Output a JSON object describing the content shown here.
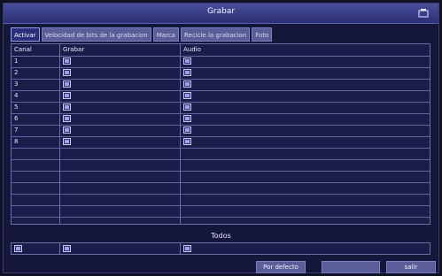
{
  "window": {
    "title": "Grabar",
    "close_icon": "close-icon"
  },
  "tabs": [
    {
      "label": "Activar",
      "active": true
    },
    {
      "label": "Velocidad de bits de la grabacion",
      "active": false
    },
    {
      "label": "Marca",
      "active": false
    },
    {
      "label": "Recicle la grabacion",
      "active": false
    },
    {
      "label": "Foto",
      "active": false
    }
  ],
  "table": {
    "headers": [
      "Canal",
      "Grabar",
      "Audio"
    ],
    "rows": [
      {
        "canal": "1",
        "grabar": true,
        "audio": true
      },
      {
        "canal": "2",
        "grabar": true,
        "audio": true
      },
      {
        "canal": "3",
        "grabar": true,
        "audio": true
      },
      {
        "canal": "4",
        "grabar": true,
        "audio": true
      },
      {
        "canal": "5",
        "grabar": true,
        "audio": true
      },
      {
        "canal": "6",
        "grabar": true,
        "audio": true
      },
      {
        "canal": "7",
        "grabar": true,
        "audio": true
      },
      {
        "canal": "8",
        "grabar": true,
        "audio": true
      }
    ]
  },
  "todos": {
    "label": "Todos"
  },
  "buttons": {
    "defaults": "Por defecto",
    "apply": "",
    "exit": "salir"
  },
  "colors": {
    "accent": "#2b2f73",
    "background": "#15173a",
    "grid_line": "#6a6ea6"
  }
}
